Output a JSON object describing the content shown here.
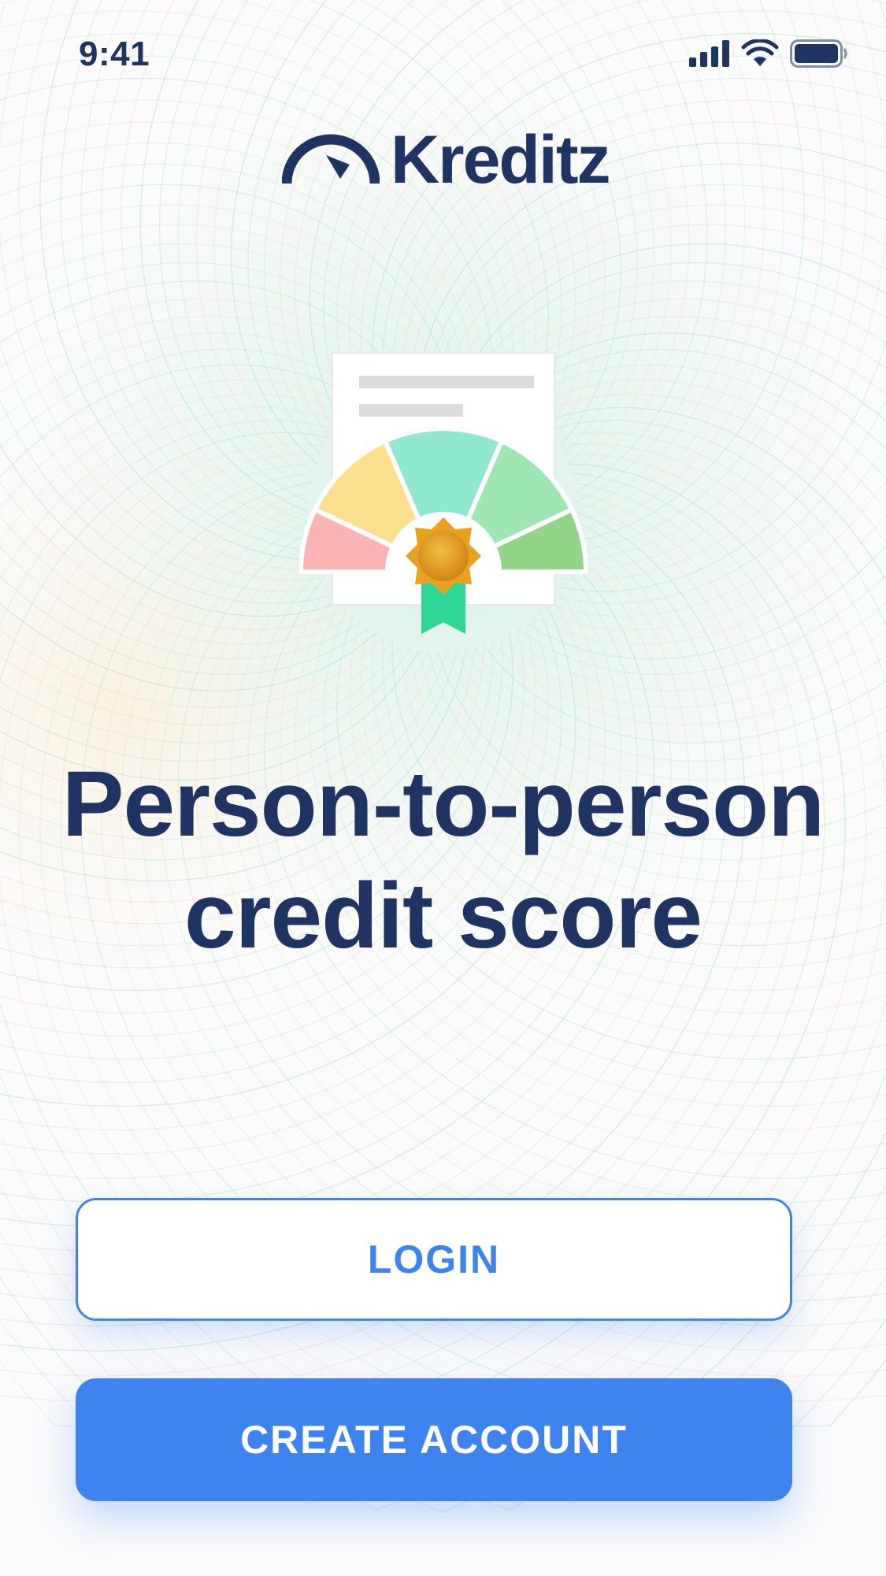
{
  "status_bar": {
    "time": "9:41",
    "icons": [
      "signal-icon",
      "wifi-icon",
      "battery-icon"
    ]
  },
  "brand": {
    "name": "Kreditz",
    "logo_icon": "gauge-icon"
  },
  "illustration": {
    "name": "credit-certificate-gauge",
    "gauge_colors": [
      "#fbb4b4",
      "#fde08e",
      "#8fe8cf",
      "#9ee7b2",
      "#93d489"
    ],
    "medal_color": "#e9a21f",
    "ribbon_color": "#2fd696"
  },
  "headline": {
    "line1": "Person-to-person",
    "line2": "credit score"
  },
  "actions": {
    "login_label": "LOGIN",
    "create_account_label": "CREATE ACCOUNT"
  },
  "colors": {
    "primary": "#3f84ee",
    "navy": "#1f3463",
    "background": "#fbfbfc"
  }
}
